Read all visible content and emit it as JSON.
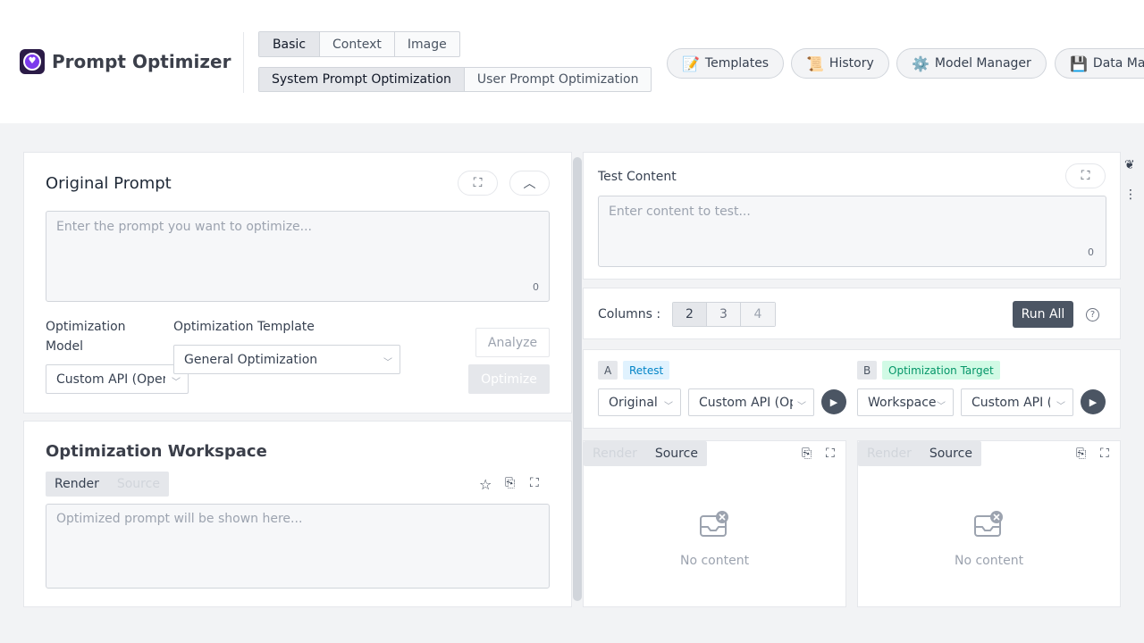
{
  "header": {
    "app_title": "Prompt Optimizer",
    "mode_tabs": [
      "Basic",
      "Context",
      "Image"
    ],
    "optimization_tabs": [
      "System Prompt Optimization",
      "User Prompt Optimization"
    ],
    "nav": [
      {
        "icon": "📝",
        "label": "Templates"
      },
      {
        "icon": "📜",
        "label": "History"
      },
      {
        "icon": "⚙️",
        "label": "Model Manager"
      },
      {
        "icon": "💾",
        "label": "Data Manager"
      }
    ]
  },
  "original_prompt": {
    "title": "Original Prompt",
    "placeholder": "Enter the prompt you want to optimize...",
    "char_count": "0",
    "model_label": "Optimization Model",
    "model_value": "Custom API (OpenAI)",
    "template_label": "Optimization Template",
    "template_value": "General Optimization",
    "analyze_label": "Analyze",
    "optimize_label": "Optimize"
  },
  "workspace": {
    "title": "Optimization Workspace",
    "render_label": "Render",
    "source_label": "Source",
    "placeholder": "Optimized prompt will be shown here..."
  },
  "test": {
    "title": "Test Content",
    "placeholder": "Enter content to test...",
    "char_count": "0",
    "columns_label": "Columns :",
    "columns": [
      "2",
      "3",
      "4"
    ],
    "run_all_label": "Run All"
  },
  "variants": {
    "a": {
      "letter": "A",
      "tag": "Retest",
      "version": "Original",
      "model": "Custom API (OpenAI)"
    },
    "b": {
      "letter": "B",
      "tag": "Optimization Target",
      "version": "Workspace",
      "model": "Custom API (OpenAI)"
    }
  },
  "results": {
    "render_label": "Render",
    "source_label": "Source",
    "empty_text": "No content"
  },
  "colors": {
    "accent": "#7c3aed",
    "dark_button": "#4b5563"
  }
}
